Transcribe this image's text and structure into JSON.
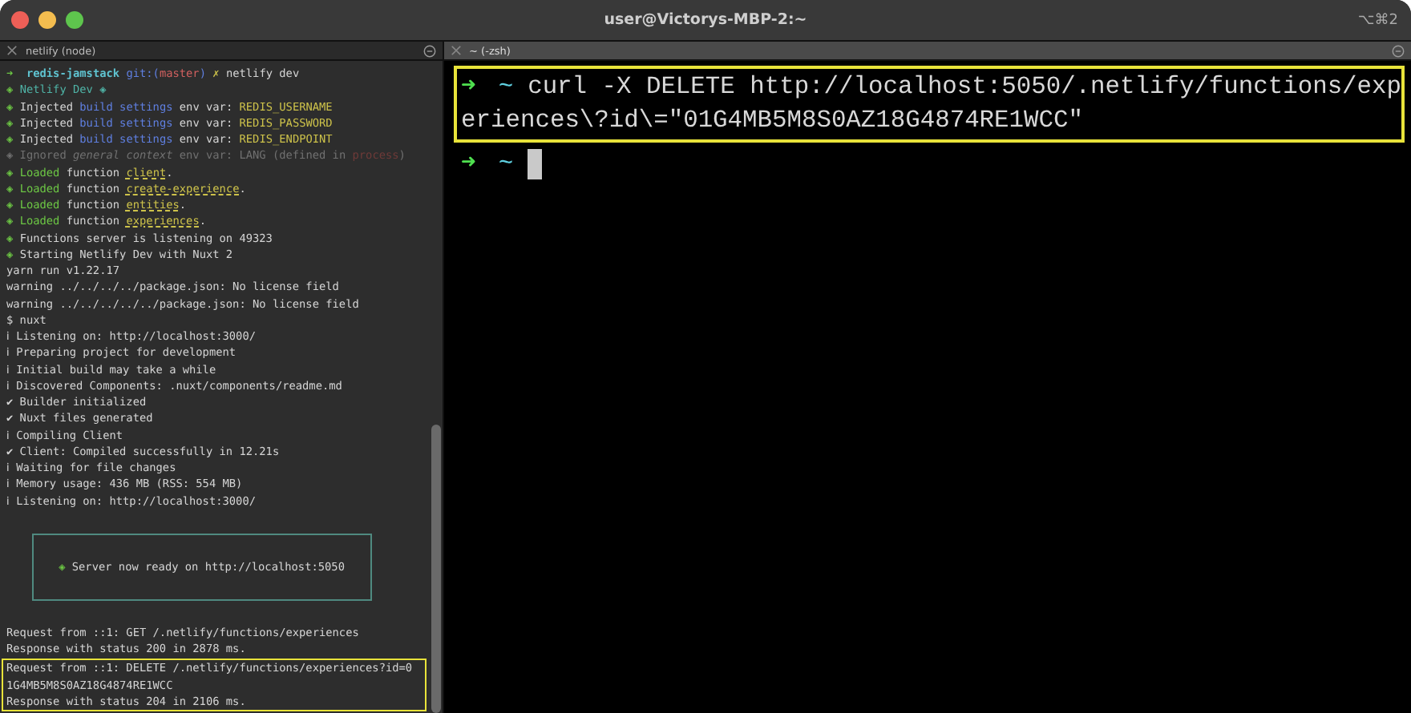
{
  "window": {
    "title": "user@Victorys-MBP-2:~",
    "shortcut": "⌥⌘2"
  },
  "left_pane": {
    "tab": {
      "title": "netlify (node)",
      "selected": false
    },
    "lines": [
      [
        {
          "text": "➜  ",
          "kind": "green"
        },
        {
          "text": "redis-jamstack ",
          "kind": "cyan"
        },
        {
          "text": "git:(",
          "kind": "blue"
        },
        {
          "text": "master",
          "kind": "red"
        },
        {
          "text": ")",
          "kind": "blue"
        },
        {
          "text": " ✗ ",
          "kind": "yellow"
        },
        {
          "text": "netlify dev",
          "kind": "plain"
        }
      ],
      [
        {
          "text": "◈ ",
          "kind": "green"
        },
        {
          "text": "Netlify Dev ◈",
          "kind": "teal"
        }
      ],
      [
        {
          "text": "◈ ",
          "kind": "green"
        },
        {
          "text": "Injected ",
          "kind": "plain"
        },
        {
          "text": "build settings",
          "kind": "blue"
        },
        {
          "text": " env var: ",
          "kind": "plain"
        },
        {
          "text": "REDIS_USERNAME",
          "kind": "yellow"
        }
      ],
      [
        {
          "text": "◈ ",
          "kind": "green"
        },
        {
          "text": "Injected ",
          "kind": "plain"
        },
        {
          "text": "build settings",
          "kind": "blue"
        },
        {
          "text": " env var: ",
          "kind": "plain"
        },
        {
          "text": "REDIS_PASSWORD",
          "kind": "yellow"
        }
      ],
      [
        {
          "text": "◈ ",
          "kind": "green"
        },
        {
          "text": "Injected ",
          "kind": "plain"
        },
        {
          "text": "build settings",
          "kind": "blue"
        },
        {
          "text": " env var: ",
          "kind": "plain"
        },
        {
          "text": "REDIS_ENDPOINT",
          "kind": "yellow"
        }
      ],
      [
        {
          "text": "◈ Ignored ",
          "kind": "dim"
        },
        {
          "text": "general context",
          "kind": "dimitalic"
        },
        {
          "text": " env var: LANG (defined in ",
          "kind": "dim"
        },
        {
          "text": "process",
          "kind": "dimred"
        },
        {
          "text": ")",
          "kind": "dim"
        }
      ],
      [
        {
          "text": "◈ ",
          "kind": "green"
        },
        {
          "text": "Loaded",
          "kind": "green"
        },
        {
          "text": " function ",
          "kind": "plain"
        },
        {
          "text": "client",
          "kind": "yellowu"
        },
        {
          "text": ".",
          "kind": "plain"
        }
      ],
      [
        {
          "text": "◈ ",
          "kind": "green"
        },
        {
          "text": "Loaded",
          "kind": "green"
        },
        {
          "text": " function ",
          "kind": "plain"
        },
        {
          "text": "create-experience",
          "kind": "yellowu"
        },
        {
          "text": ".",
          "kind": "plain"
        }
      ],
      [
        {
          "text": "◈ ",
          "kind": "green"
        },
        {
          "text": "Loaded",
          "kind": "green"
        },
        {
          "text": " function ",
          "kind": "plain"
        },
        {
          "text": "entities",
          "kind": "yellowu"
        },
        {
          "text": ".",
          "kind": "plain"
        }
      ],
      [
        {
          "text": "◈ ",
          "kind": "green"
        },
        {
          "text": "Loaded",
          "kind": "green"
        },
        {
          "text": " function ",
          "kind": "plain"
        },
        {
          "text": "experiences",
          "kind": "yellowu"
        },
        {
          "text": ".",
          "kind": "plain"
        }
      ],
      [
        {
          "text": "◈ ",
          "kind": "green"
        },
        {
          "text": "Functions server is listening on 49323",
          "kind": "plain"
        }
      ],
      [
        {
          "text": "◈ ",
          "kind": "green"
        },
        {
          "text": "Starting Netlify Dev with Nuxt 2",
          "kind": "plain"
        }
      ],
      [
        {
          "text": "yarn run v1.22.17",
          "kind": "plain"
        }
      ],
      [
        {
          "text": "warning ../../../../package.json: No license field",
          "kind": "plain"
        }
      ],
      [
        {
          "text": "warning ../../../../../package.json: No license field",
          "kind": "plain"
        }
      ],
      [
        {
          "text": "$ nuxt",
          "kind": "plain"
        }
      ],
      [
        {
          "text": "ℹ Listening on: http://localhost:3000/",
          "kind": "plain"
        }
      ],
      [
        {
          "text": "ℹ Preparing project for development",
          "kind": "plain"
        }
      ],
      [
        {
          "text": "ℹ Initial build may take a while",
          "kind": "plain"
        }
      ],
      [
        {
          "text": "ℹ Discovered Components: .nuxt/components/readme.md",
          "kind": "plain"
        }
      ],
      [
        {
          "text": "✔ Builder initialized",
          "kind": "plain"
        }
      ],
      [
        {
          "text": "✔ Nuxt files generated",
          "kind": "plain"
        }
      ],
      [
        {
          "text": "ℹ Compiling Client",
          "kind": "plain"
        }
      ],
      [
        {
          "text": "✔ Client: Compiled successfully in 12.21s",
          "kind": "plain"
        }
      ],
      [
        {
          "text": "ℹ Waiting for file changes",
          "kind": "plain"
        }
      ],
      [
        {
          "text": "ℹ Memory usage: 436 MB (RSS: 554 MB)",
          "kind": "plain"
        }
      ],
      [
        {
          "text": "ℹ Listening on: http://localhost:3000/",
          "kind": "plain"
        }
      ]
    ],
    "ready_box": {
      "icon": "◈",
      "text": "Server now ready on http://localhost:5050"
    },
    "requests": [
      {
        "highlighted": false,
        "lines": [
          "Request from ::1: GET /.netlify/functions/experiences",
          "Response with status 200 in 2878 ms."
        ]
      },
      {
        "highlighted": true,
        "lines": [
          "Request from ::1: DELETE /.netlify/functions/experiences?id=0",
          "1G4MB5M8S0AZ18G4874RE1WCC",
          "Response with status 204 in 2106 ms."
        ]
      }
    ]
  },
  "right_pane": {
    "tab": {
      "title": "~ (-zsh)",
      "selected": true
    },
    "blocks": [
      {
        "highlighted": true,
        "prompt": "➜",
        "dir": "~",
        "lines": [
          "curl -X DELETE http://localhost:5050/.netlify/functions/exp",
          "eriences\\?id\\=\"01G4MB5M8S0AZ18G4874RE1WCC\""
        ]
      },
      {
        "highlighted": false,
        "prompt": "➜",
        "dir": "~"
      }
    ]
  }
}
